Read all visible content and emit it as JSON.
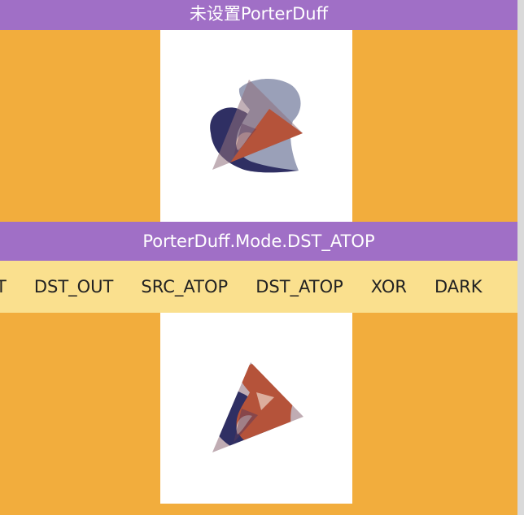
{
  "header": {
    "title": "未设置PorterDuff"
  },
  "mode_bar": {
    "label": "PorterDuff.Mode.DST_ATOP"
  },
  "tabs": [
    {
      "label": "T"
    },
    {
      "label": "DST_OUT"
    },
    {
      "label": "SRC_ATOP"
    },
    {
      "label": "DST_ATOP"
    },
    {
      "label": "XOR"
    },
    {
      "label": "DARK"
    }
  ],
  "colors": {
    "background": "#f2ad3d",
    "title_bar": "#a06fc6",
    "tab_strip": "#fae08e",
    "canvas": "#ffffff",
    "blob_dark": "#2f2f63",
    "blob_light": "#9aa0b8",
    "triangle_orange": "#b5533a",
    "triangle_mauve": "#9e7f8a"
  }
}
